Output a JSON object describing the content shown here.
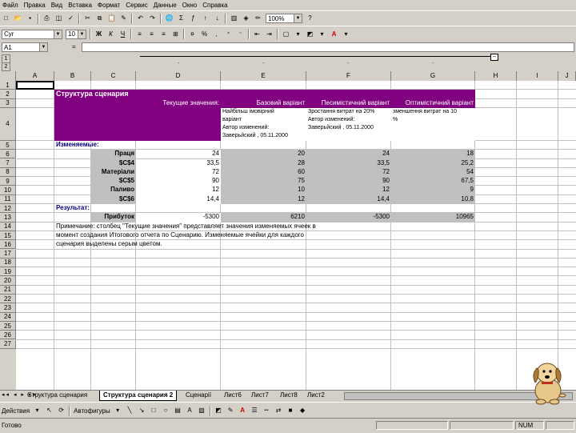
{
  "menu": [
    "Файл",
    "Правка",
    "Вид",
    "Вставка",
    "Формат",
    "Сервис",
    "Данные",
    "Окно",
    "Справка"
  ],
  "toolbar": {
    "zoom": "100%",
    "help": "?"
  },
  "format_toolbar": {
    "font": "Cyr",
    "size": "10",
    "bold": "Ж",
    "italic": "К",
    "underline": "Ч"
  },
  "formula_bar": {
    "name_box": "A1",
    "fx": "="
  },
  "columns": [
    "A",
    "B",
    "C",
    "D",
    "E",
    "F",
    "G",
    "H",
    "I",
    "J"
  ],
  "rows": [
    "1",
    "2",
    "3",
    "4",
    "5",
    "6",
    "7",
    "8",
    "9",
    "10",
    "11",
    "12",
    "13",
    "14",
    "15",
    "16",
    "17",
    "18",
    "19",
    "20",
    "21",
    "22",
    "23",
    "24",
    "25",
    "26",
    "27"
  ],
  "outline_dots": [
    ".",
    ".",
    ".",
    "."
  ],
  "sheet": {
    "title": "Структура сценария",
    "headers": [
      "Текущие значения:",
      "Базовий варіант",
      "Песимістичний варіант",
      "Оптимістичний варіант"
    ],
    "desc_base": [
      "Найбільш імовірний",
      "варіант",
      "Автор изменений:",
      "Заверьйский , 05.11.2000"
    ],
    "desc_pess": [
      "Зростання витрат на 20%",
      "Автор изменений:",
      "Заверьйский , 05.11.2000"
    ],
    "desc_opt": [
      "зменшення витрат на 10",
      "%"
    ],
    "changing_label": "Изменяемые:",
    "changing_rows": [
      {
        "label": "Праця",
        "vals": [
          "24",
          "20",
          "24",
          "18"
        ]
      },
      {
        "label": "$C$4",
        "vals": [
          "33,5",
          "28",
          "33,5",
          "25,2"
        ]
      },
      {
        "label": "Матеріали",
        "vals": [
          "72",
          "60",
          "72",
          "54"
        ]
      },
      {
        "label": "$C$5",
        "vals": [
          "90",
          "75",
          "90",
          "67,5"
        ]
      },
      {
        "label": "Паливо",
        "vals": [
          "12",
          "10",
          "12",
          "9"
        ]
      },
      {
        "label": "$C$6",
        "vals": [
          "14,4",
          "12",
          "14,4",
          "10,8"
        ]
      }
    ],
    "result_label": "Результат:",
    "result_row": {
      "label": "Прибуток",
      "vals": [
        "-5300",
        "6210",
        "-5300",
        "10965"
      ]
    },
    "notes": [
      "Примечание: столбец \"Текущие значения\" представляет значения изменяемых ячеек в",
      "момент создания Итогового отчета по Сценарию. Изменяемые ячейки для каждого",
      "сценария выделены серым цветом."
    ]
  },
  "tabs": [
    "Структура сценария",
    "Структура сценария 2",
    "Сценарії",
    "Лист6",
    "Лист7",
    "Лист8",
    "Лист2"
  ],
  "drawing": {
    "draw_label": "Действия",
    "autoshapes_label": "Автофигуры"
  },
  "status": {
    "left": "Готово",
    "num": "NUM"
  }
}
